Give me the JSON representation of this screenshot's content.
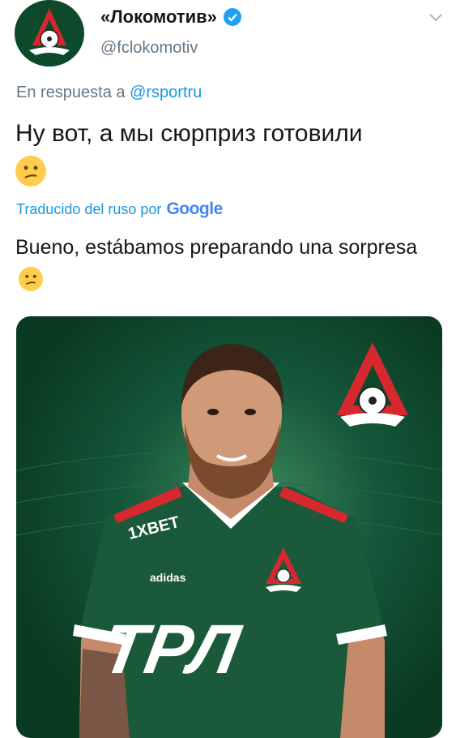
{
  "tweet": {
    "display_name": "«Локомотив»",
    "handle": "@fclokomotiv",
    "reply_prefix": "En respuesta a ",
    "reply_mention": "@rsportru",
    "text": "Ну вот, а мы сюрприз готовили",
    "translated_by_label": "Traducido del ruso por",
    "translator_logo_text": "Google",
    "translation": "Bueno, estábamos preparando una sorpresa"
  },
  "media": {
    "jersey_sponsor": "ТРЛ",
    "jersey_brand_top": "1XBET",
    "jersey_brand_adidas": "adidas"
  },
  "colors": {
    "accent": "#1b95e0",
    "verified": "#1da1f2",
    "club_green": "#0e4a2a",
    "club_red": "#d7282f"
  }
}
